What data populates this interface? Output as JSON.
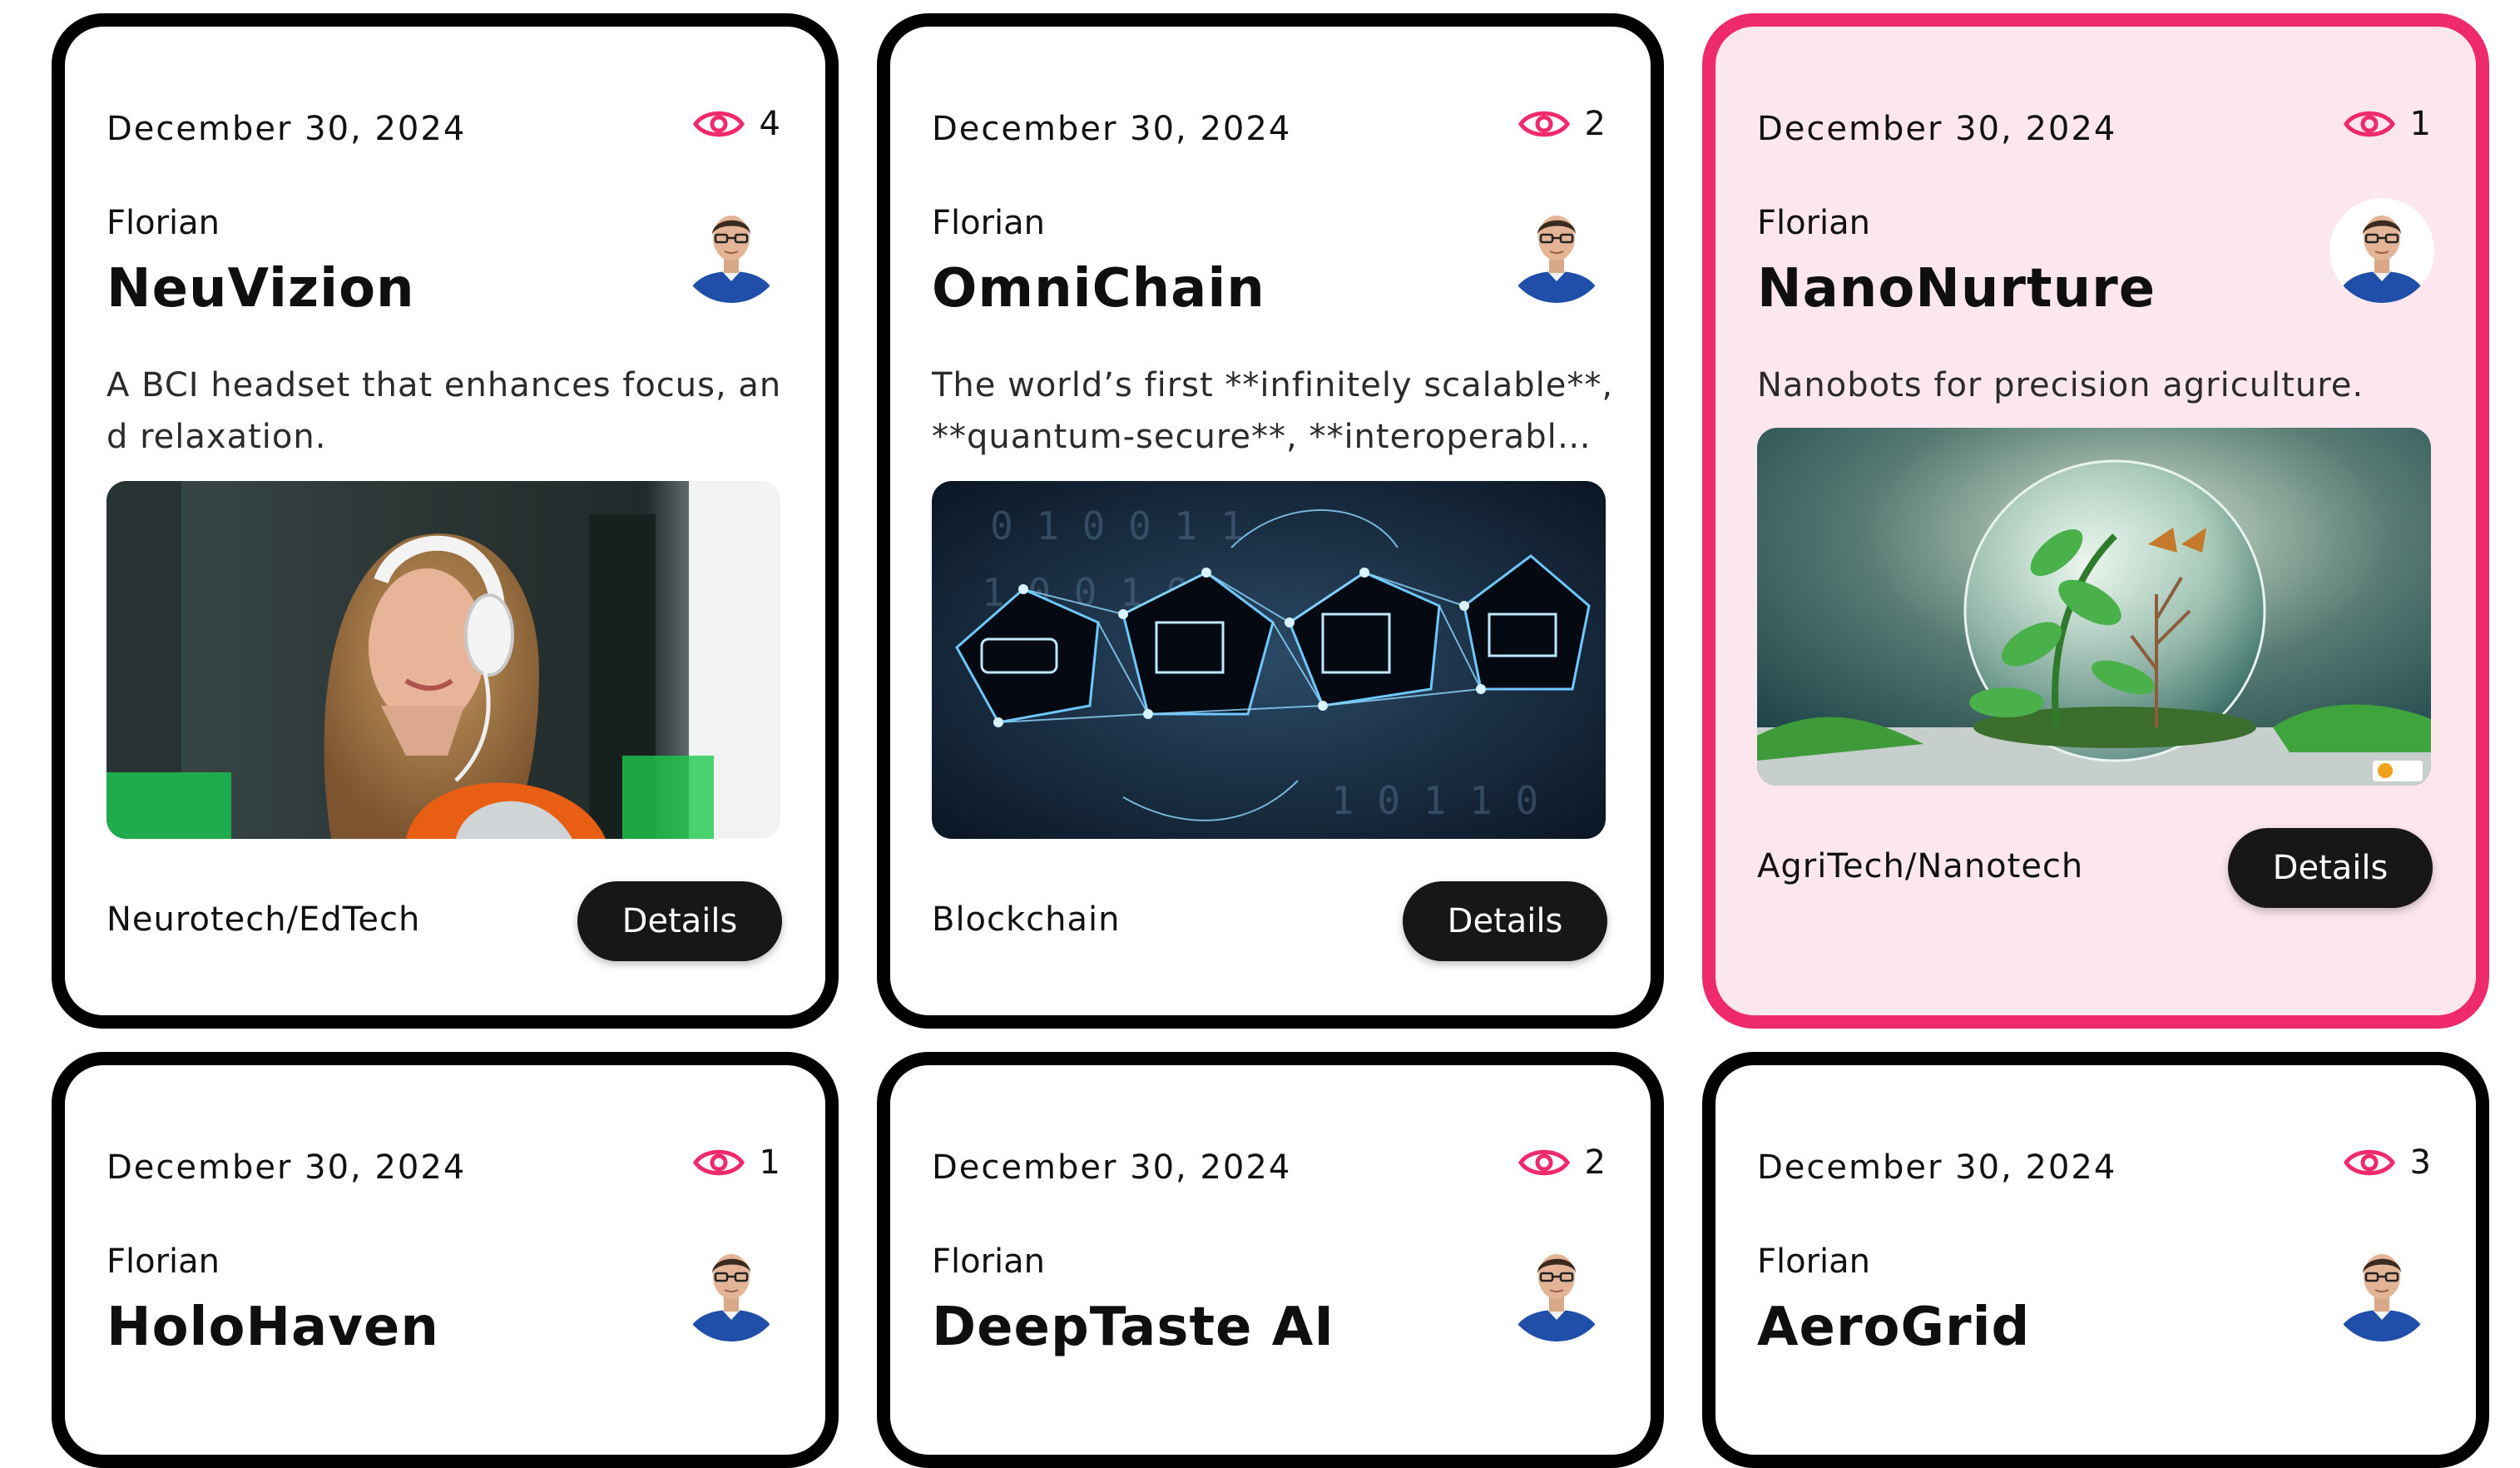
{
  "colors": {
    "accent": "#ee2a6c",
    "card_border": "#000000",
    "highlight_bg": "#fde7ef",
    "button_bg": "#171717"
  },
  "icons": {
    "views": "eye-icon"
  },
  "cards": [
    {
      "date": "December 30, 2024",
      "views": "4",
      "author": "Florian",
      "title": "NeuVizion",
      "description": "A BCI headset that enhances focus, and relaxation.",
      "image_alt": "woman-with-headphones-image",
      "category": "Neurotech/EdTech",
      "button": "Details",
      "highlighted": false
    },
    {
      "date": "December 30, 2024",
      "views": "2",
      "author": "Florian",
      "title": "OmniChain",
      "description": "The world’s first **infinitely scalable**, **quantum-secure**, **interoperabl…",
      "image_alt": "blockchain-network-image",
      "category": "Blockchain",
      "button": "Details",
      "highlighted": false
    },
    {
      "date": "December 30, 2024",
      "views": "1",
      "author": "Florian",
      "title": "NanoNurture",
      "description": "Nanobots for precision agriculture.",
      "image_alt": "plant-in-glass-sphere-image",
      "category": "AgriTech/Nanotech",
      "button": "Details",
      "highlighted": true
    },
    {
      "date": "December 30, 2024",
      "views": "1",
      "author": "Florian",
      "title": "HoloHaven"
    },
    {
      "date": "December 30, 2024",
      "views": "2",
      "author": "Florian",
      "title": "DeepTaste AI"
    },
    {
      "date": "December 30, 2024",
      "views": "3",
      "author": "Florian",
      "title": "AeroGrid"
    }
  ]
}
